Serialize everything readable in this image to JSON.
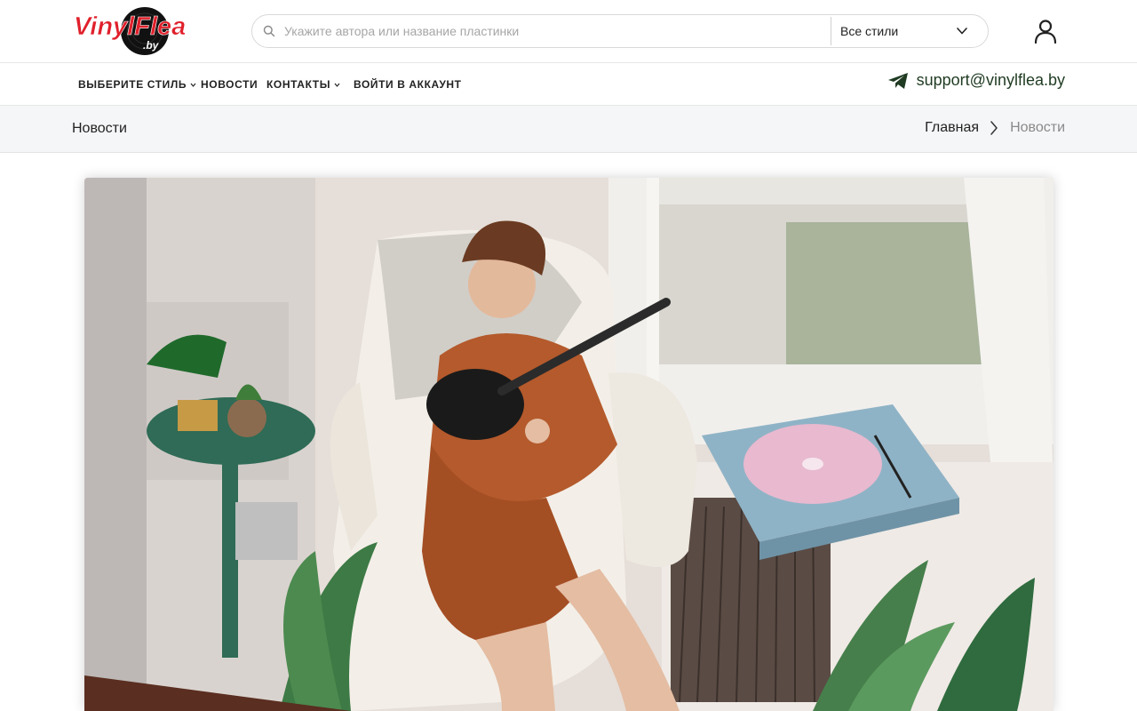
{
  "logo": {
    "text": "VinylFlea",
    "subtext": ".by"
  },
  "search": {
    "placeholder": "Укажите автора или название пластинки",
    "value": ""
  },
  "style_select": {
    "selected": "Все стили"
  },
  "nav": {
    "items": [
      {
        "label": "ВЫБЕРИТЕ СТИЛЬ",
        "has_dropdown": true
      },
      {
        "label": "НОВОСТИ",
        "has_dropdown": false
      },
      {
        "label": "КОНТАКТЫ",
        "has_dropdown": true
      },
      {
        "label": "ВОЙТИ В АККАУНТ",
        "has_dropdown": false
      }
    ],
    "support_email": "support@vinylflea.by"
  },
  "page": {
    "title": "Новости"
  },
  "breadcrumb": {
    "home": "Главная",
    "current": "Новости"
  },
  "icons": {
    "search": "search-icon",
    "dropdown": "chevron-down-icon",
    "user": "user-icon",
    "telegram": "telegram-icon",
    "breadcrumb_separator": "chevron-right-icon"
  },
  "colors": {
    "logo_red": "#e0202b",
    "accent_green": "#1f3b22",
    "crumb_bg": "#f5f6f8"
  }
}
